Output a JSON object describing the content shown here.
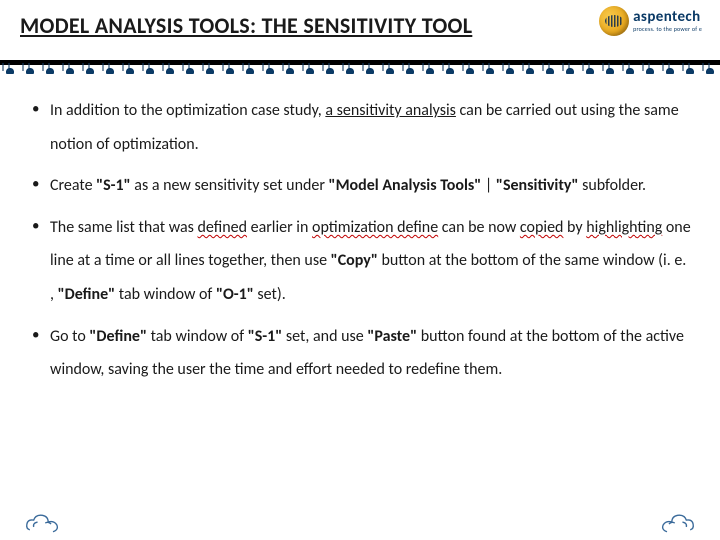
{
  "header": {
    "title": "MODEL ANALYSIS TOOLS: THE SENSITIVITY TOOL",
    "brand": "aspentech",
    "brand_sub": "process. to the power of e"
  },
  "bullets": [
    {
      "runs": [
        {
          "t": "In addition to the optimization case study, "
        },
        {
          "t": "a sensitivity analysis",
          "cls": "u"
        },
        {
          "t": " can be carried out using the same notion of optimization."
        }
      ]
    },
    {
      "runs": [
        {
          "t": " Create "
        },
        {
          "t": "\"S-1\"",
          "cls": "b"
        },
        {
          "t": " as a new sensitivity set under "
        },
        {
          "t": "\"Model Analysis Tools\"",
          "cls": "b"
        },
        {
          "t": " | "
        },
        {
          "t": "\"Sensitivity\"",
          "cls": "b"
        },
        {
          "t": " subfolder."
        }
      ]
    },
    {
      "runs": [
        {
          "t": "The same list that was "
        },
        {
          "t": "defined",
          "cls": "w"
        },
        {
          "t": " earlier in "
        },
        {
          "t": "optimization define",
          "cls": "w"
        },
        {
          "t": " can be now "
        },
        {
          "t": "copied",
          "cls": "w"
        },
        {
          "t": " by "
        },
        {
          "t": "highlighting",
          "cls": "w"
        },
        {
          "t": " one line at a time or all lines together, then use "
        },
        {
          "t": "\"Copy\"",
          "cls": "b"
        },
        {
          "t": " button at the bottom of the same window (i. e. , "
        },
        {
          "t": "\"Define\"",
          "cls": "b"
        },
        {
          "t": " tab window of "
        },
        {
          "t": "\"O-1\"",
          "cls": "b"
        },
        {
          "t": " set)."
        }
      ]
    },
    {
      "runs": [
        {
          "t": "Go to "
        },
        {
          "t": "\"Define\"",
          "cls": "b"
        },
        {
          "t": " tab window of "
        },
        {
          "t": "\"S-1\"",
          "cls": "b"
        },
        {
          "t": " set, and use "
        },
        {
          "t": "\"Paste\"",
          "cls": "b"
        },
        {
          "t": " button found at the bottom of the active window, saving the user the time and effort needed to redefine them."
        }
      ]
    }
  ]
}
